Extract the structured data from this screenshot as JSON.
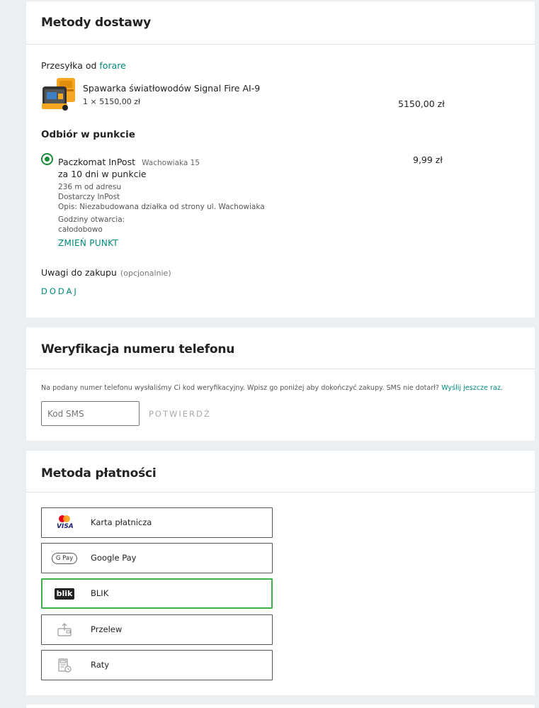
{
  "delivery": {
    "title": "Metody dostawy",
    "shipment_prefix": "Przesyłka od",
    "seller": "forare",
    "product": {
      "name": "Spawarka światłowodów Signal Fire AI-9",
      "qty_price": "1 × 5150,00 zł",
      "total": "5150,00 zł"
    },
    "pickup_heading": "Odbiór w punkcie",
    "option": {
      "name": "Paczkomat InPost",
      "address": "Wachowiaka 15",
      "price": "9,99 zł",
      "eta": "za 10 dni w punkcie",
      "distance": "236 m od adresu",
      "carrier": "Dostarczy InPost",
      "description": "Opis: Niezabudowana działka od strony ul. Wachowiaka",
      "hours_label": "Godziny otwarcia:",
      "hours_value": "całodobowo",
      "change_label": "ZMIEŃ PUNKT"
    },
    "notes_label": "Uwagi do zakupu",
    "notes_optional": "(opcjonalnie)",
    "notes_add": "DODAJ"
  },
  "phone": {
    "title": "Weryfikacja numeru telefonu",
    "info": "Na podany numer telefonu wysłaliśmy Ci kod weryfikacyjny. Wpisz go poniżej aby dokończyć zakupy. SMS nie dotarł?",
    "resend": "Wyślij jeszcze raz.",
    "sms_placeholder": "Kod SMS",
    "confirm": "POTWIERDŹ"
  },
  "payment": {
    "title": "Metoda płatności",
    "options": [
      {
        "label": "Karta płatnicza",
        "icon": "visa-mastercard-icon"
      },
      {
        "label": "Google Pay",
        "icon": "google-pay-icon"
      },
      {
        "label": "BLIK",
        "icon": "blik-icon",
        "selected": true,
        "icon_text": "blik"
      },
      {
        "label": "Przelew",
        "icon": "transfer-icon"
      },
      {
        "label": "Raty",
        "icon": "installments-icon"
      }
    ],
    "visa_text": "VISA",
    "gpay_text": "G Pay"
  },
  "colors": {
    "accent": "#00897b",
    "selected_border": "#3cb34a",
    "background": "#eceff1"
  }
}
